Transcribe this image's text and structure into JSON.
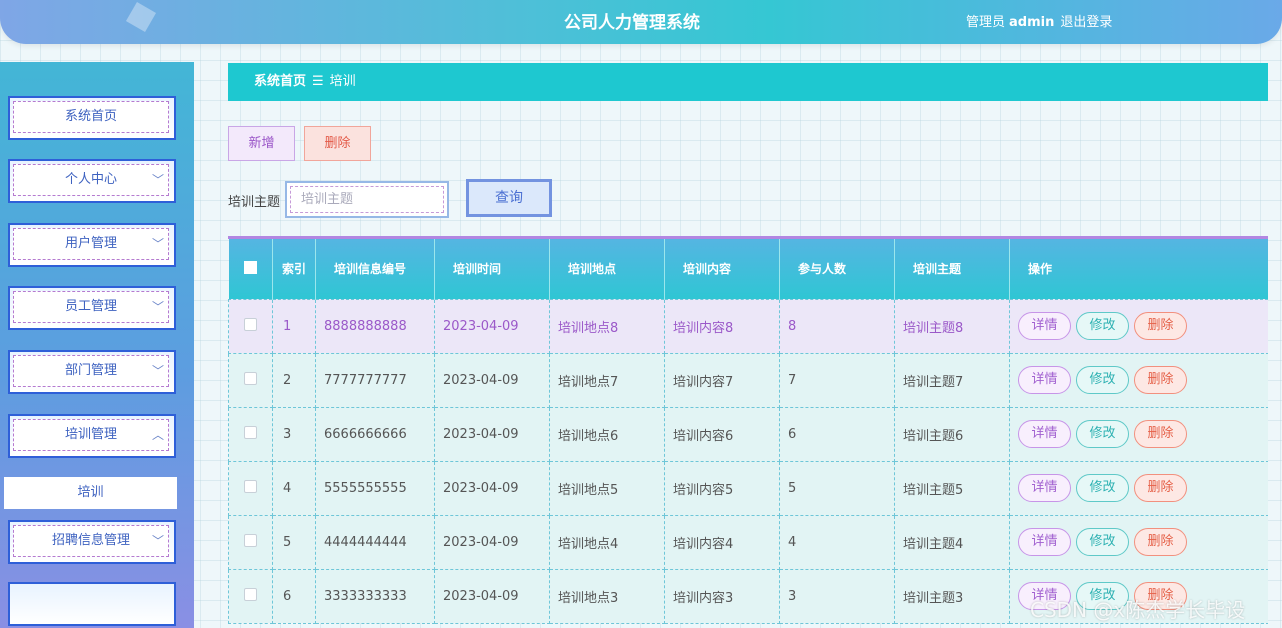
{
  "header": {
    "title": "公司人力管理系统",
    "role": "管理员",
    "username": "admin",
    "logout": "退出登录"
  },
  "sidebar": {
    "items": [
      {
        "label": "系统首页",
        "arrow": ""
      },
      {
        "label": "个人中心",
        "arrow": "﹀"
      },
      {
        "label": "用户管理",
        "arrow": "﹀"
      },
      {
        "label": "员工管理",
        "arrow": "﹀"
      },
      {
        "label": "部门管理",
        "arrow": "﹀"
      },
      {
        "label": "培训管理",
        "arrow": "︿"
      },
      {
        "label": "招聘信息管理",
        "arrow": "﹀"
      }
    ],
    "submenu_active": "培训"
  },
  "breadcrumb": {
    "home": "系统首页",
    "separator": "☰",
    "current": "培训"
  },
  "toolbar": {
    "add_label": "新增",
    "delete_label": "删除",
    "search_label": "培训主题",
    "search_placeholder": "培训主题",
    "query_label": "查询"
  },
  "table": {
    "headers": {
      "index": "索引",
      "code": "培训信息编号",
      "time": "培训时间",
      "place": "培训地点",
      "content": "培训内容",
      "count": "参与人数",
      "topic": "培训主题",
      "ops": "操作"
    },
    "rows": [
      {
        "idx": "1",
        "code": "8888888888",
        "time": "2023-04-09",
        "place": "培训地点8",
        "content": "培训内容8",
        "count": "8",
        "topic": "培训主题8"
      },
      {
        "idx": "2",
        "code": "7777777777",
        "time": "2023-04-09",
        "place": "培训地点7",
        "content": "培训内容7",
        "count": "7",
        "topic": "培训主题7"
      },
      {
        "idx": "3",
        "code": "6666666666",
        "time": "2023-04-09",
        "place": "培训地点6",
        "content": "培训内容6",
        "count": "6",
        "topic": "培训主题6"
      },
      {
        "idx": "4",
        "code": "5555555555",
        "time": "2023-04-09",
        "place": "培训地点5",
        "content": "培训内容5",
        "count": "5",
        "topic": "培训主题5"
      },
      {
        "idx": "5",
        "code": "4444444444",
        "time": "2023-04-09",
        "place": "培训地点4",
        "content": "培训内容4",
        "count": "4",
        "topic": "培训主题4"
      },
      {
        "idx": "6",
        "code": "3333333333",
        "time": "2023-04-09",
        "place": "培训地点3",
        "content": "培训内容3",
        "count": "3",
        "topic": "培训主题3"
      }
    ],
    "op_labels": {
      "detail": "详情",
      "edit": "修改",
      "delete": "删除"
    }
  },
  "watermark": "CSDN @x陈杰学长毕设",
  "colors": {
    "accent": "#1ec8d0",
    "sidebar_border": "#2e5fd8",
    "header_gradient_start": "#7fa6e6",
    "table_header": "#2fc6d4"
  }
}
